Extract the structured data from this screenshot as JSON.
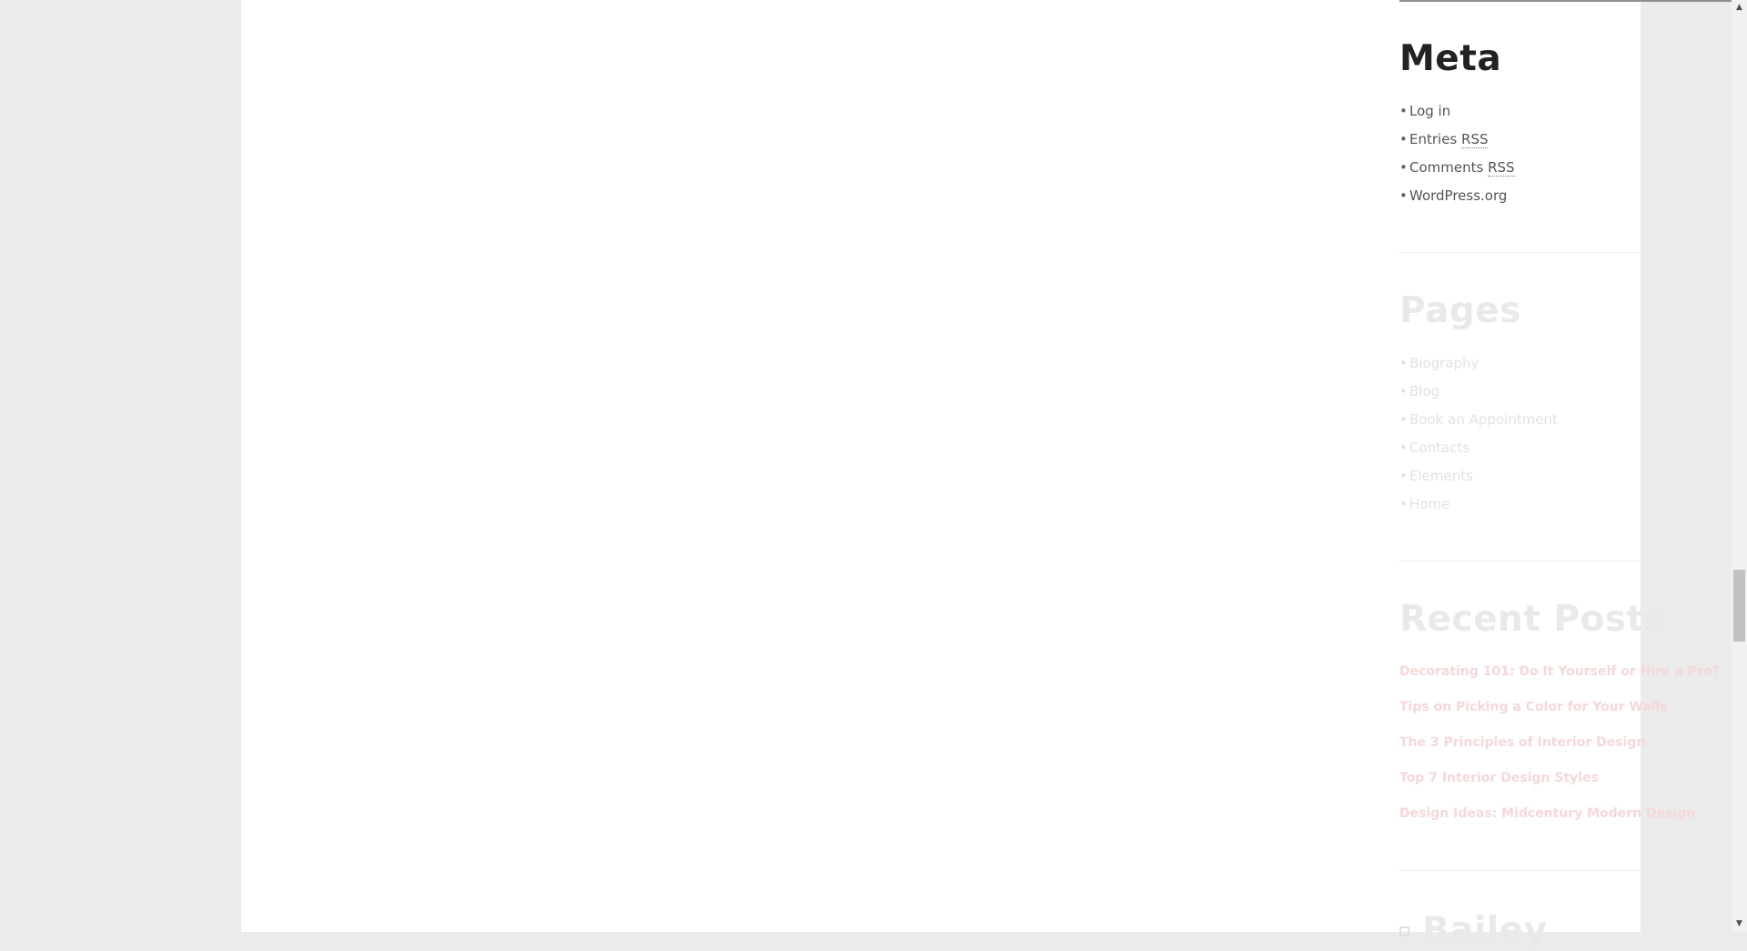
{
  "sidebar": {
    "meta": {
      "title": "Meta",
      "items": [
        {
          "label": "Log in",
          "abbr": ""
        },
        {
          "label": "Entries ",
          "abbr": "RSS"
        },
        {
          "label": "Comments ",
          "abbr": "RSS"
        },
        {
          "label": "WordPress.org",
          "abbr": ""
        }
      ]
    },
    "pages": {
      "title": "Pages",
      "items": [
        "Biography",
        "Blog",
        "Book an Appointment",
        "Contacts",
        "Elements",
        "Home"
      ]
    },
    "recent_posts": {
      "title": "Recent Posts",
      "items": [
        "Decorating 101: Do It Yourself or Hire a Pro?",
        "Tips on Picking a Color for Your Walls",
        "The 3 Principles of Interior Design",
        "Top 7 Interior Design Styles",
        "Design Ideas: Midcentury Modern Design"
      ]
    },
    "bailey": {
      "title": "Bailey"
    },
    "bullet": "•"
  },
  "scrollbar": {
    "up_arrow": "▲",
    "down_arrow": "▼"
  },
  "colors": {
    "page_background": "#ebebeb",
    "content_background": "#ffffff",
    "heading_active": "#222222",
    "link_text": "#555555",
    "faded_text": "#e9e9e9",
    "faded_accent": "#f6d8d8"
  }
}
